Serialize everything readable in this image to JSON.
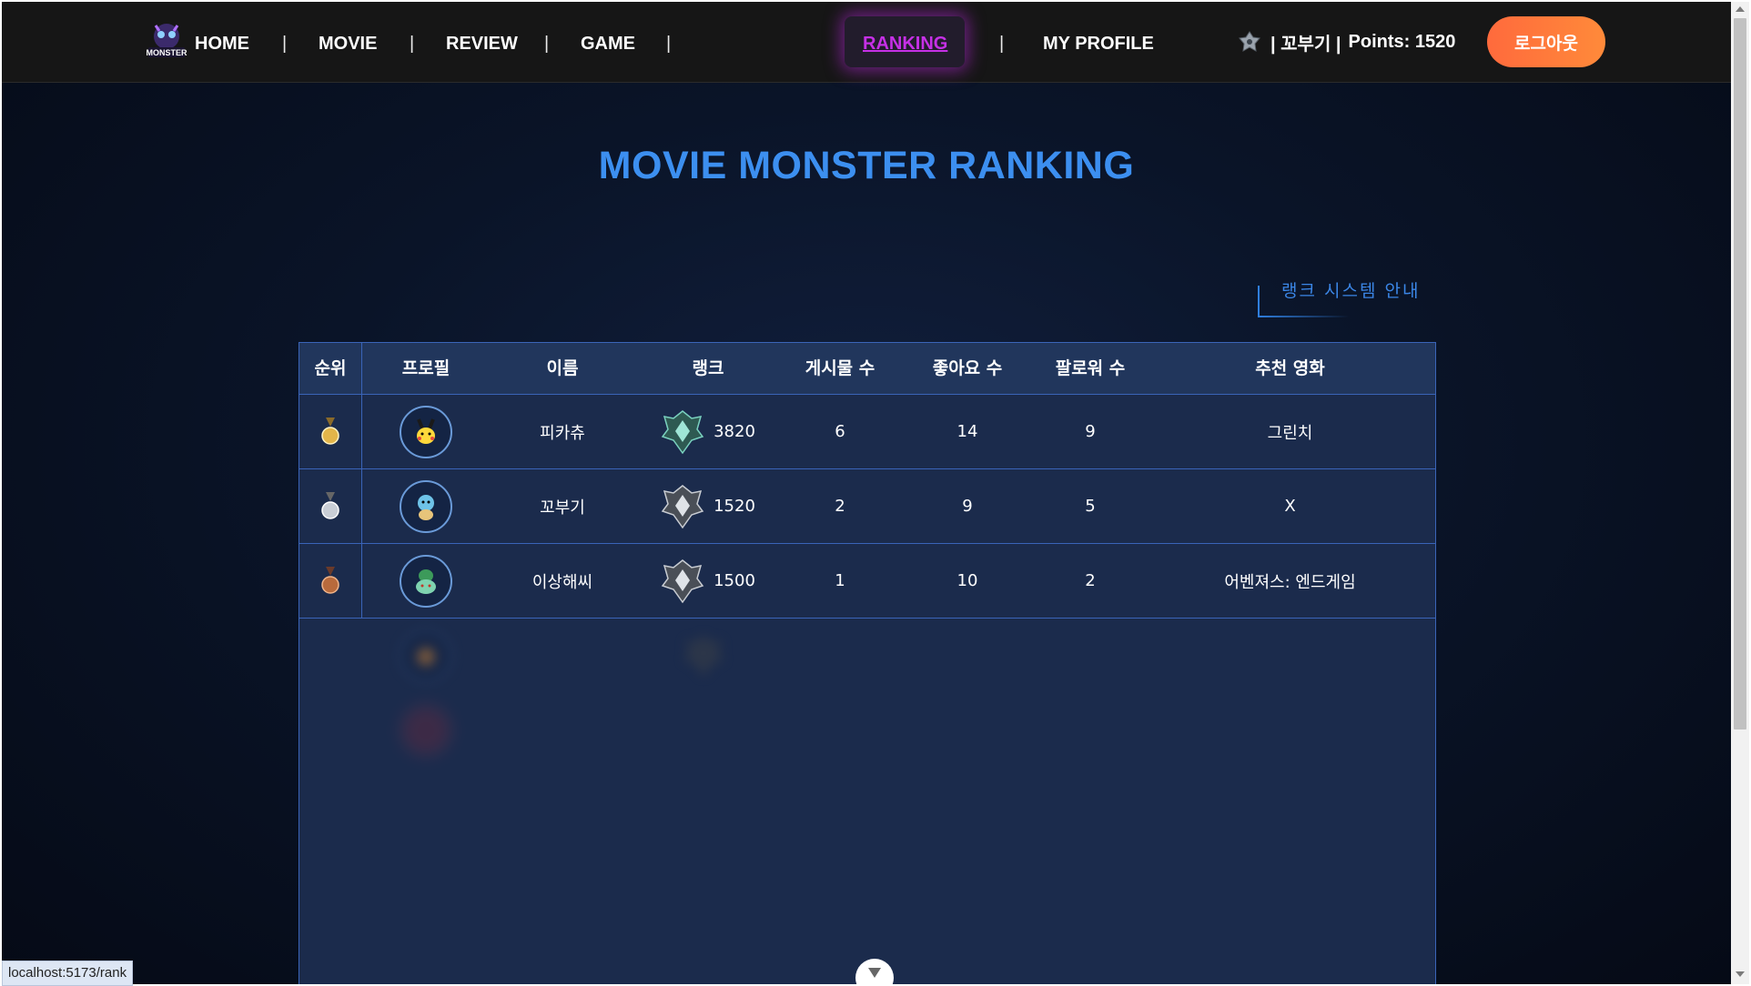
{
  "nav": {
    "items": [
      {
        "label": "HOME"
      },
      {
        "label": "MOVIE"
      },
      {
        "label": "REVIEW"
      },
      {
        "label": "GAME"
      },
      {
        "label": "RANKING",
        "active": true
      },
      {
        "label": "MY PROFILE"
      }
    ],
    "separator": "|",
    "user": {
      "name": "| 꼬부기 |",
      "points_label": "Points: 1520"
    },
    "logout_label": "로그아웃",
    "logo_text": "MONSTER"
  },
  "page": {
    "title": "MOVIE MONSTER RANKING",
    "guide_label": "랭크 시스템 안내"
  },
  "table": {
    "columns": [
      "순위",
      "프로필",
      "이름",
      "랭크",
      "게시물 수",
      "좋아요 수",
      "팔로워 수",
      "추천 영화"
    ],
    "rows": [
      {
        "medal": "gold",
        "avatar": "pikachu",
        "name": "피카츄",
        "rank_points": "3820",
        "posts": "6",
        "likes": "14",
        "followers": "9",
        "movie": "그린치"
      },
      {
        "medal": "silver",
        "avatar": "squirtle",
        "name": "꼬부기",
        "rank_points": "1520",
        "posts": "2",
        "likes": "9",
        "followers": "5",
        "movie": "X"
      },
      {
        "medal": "bronze",
        "avatar": "bulbasaur",
        "name": "이상해씨",
        "rank_points": "1500",
        "posts": "1",
        "likes": "10",
        "followers": "2",
        "movie": "어벤져스: 엔드게임"
      }
    ]
  },
  "status_bar": "localhost:5173/rank",
  "colors": {
    "accent_blue": "#3c8ff0",
    "active_nav": "#c630e6",
    "logout": "#ff7a3a",
    "table_bg": "#1b2b4c"
  }
}
